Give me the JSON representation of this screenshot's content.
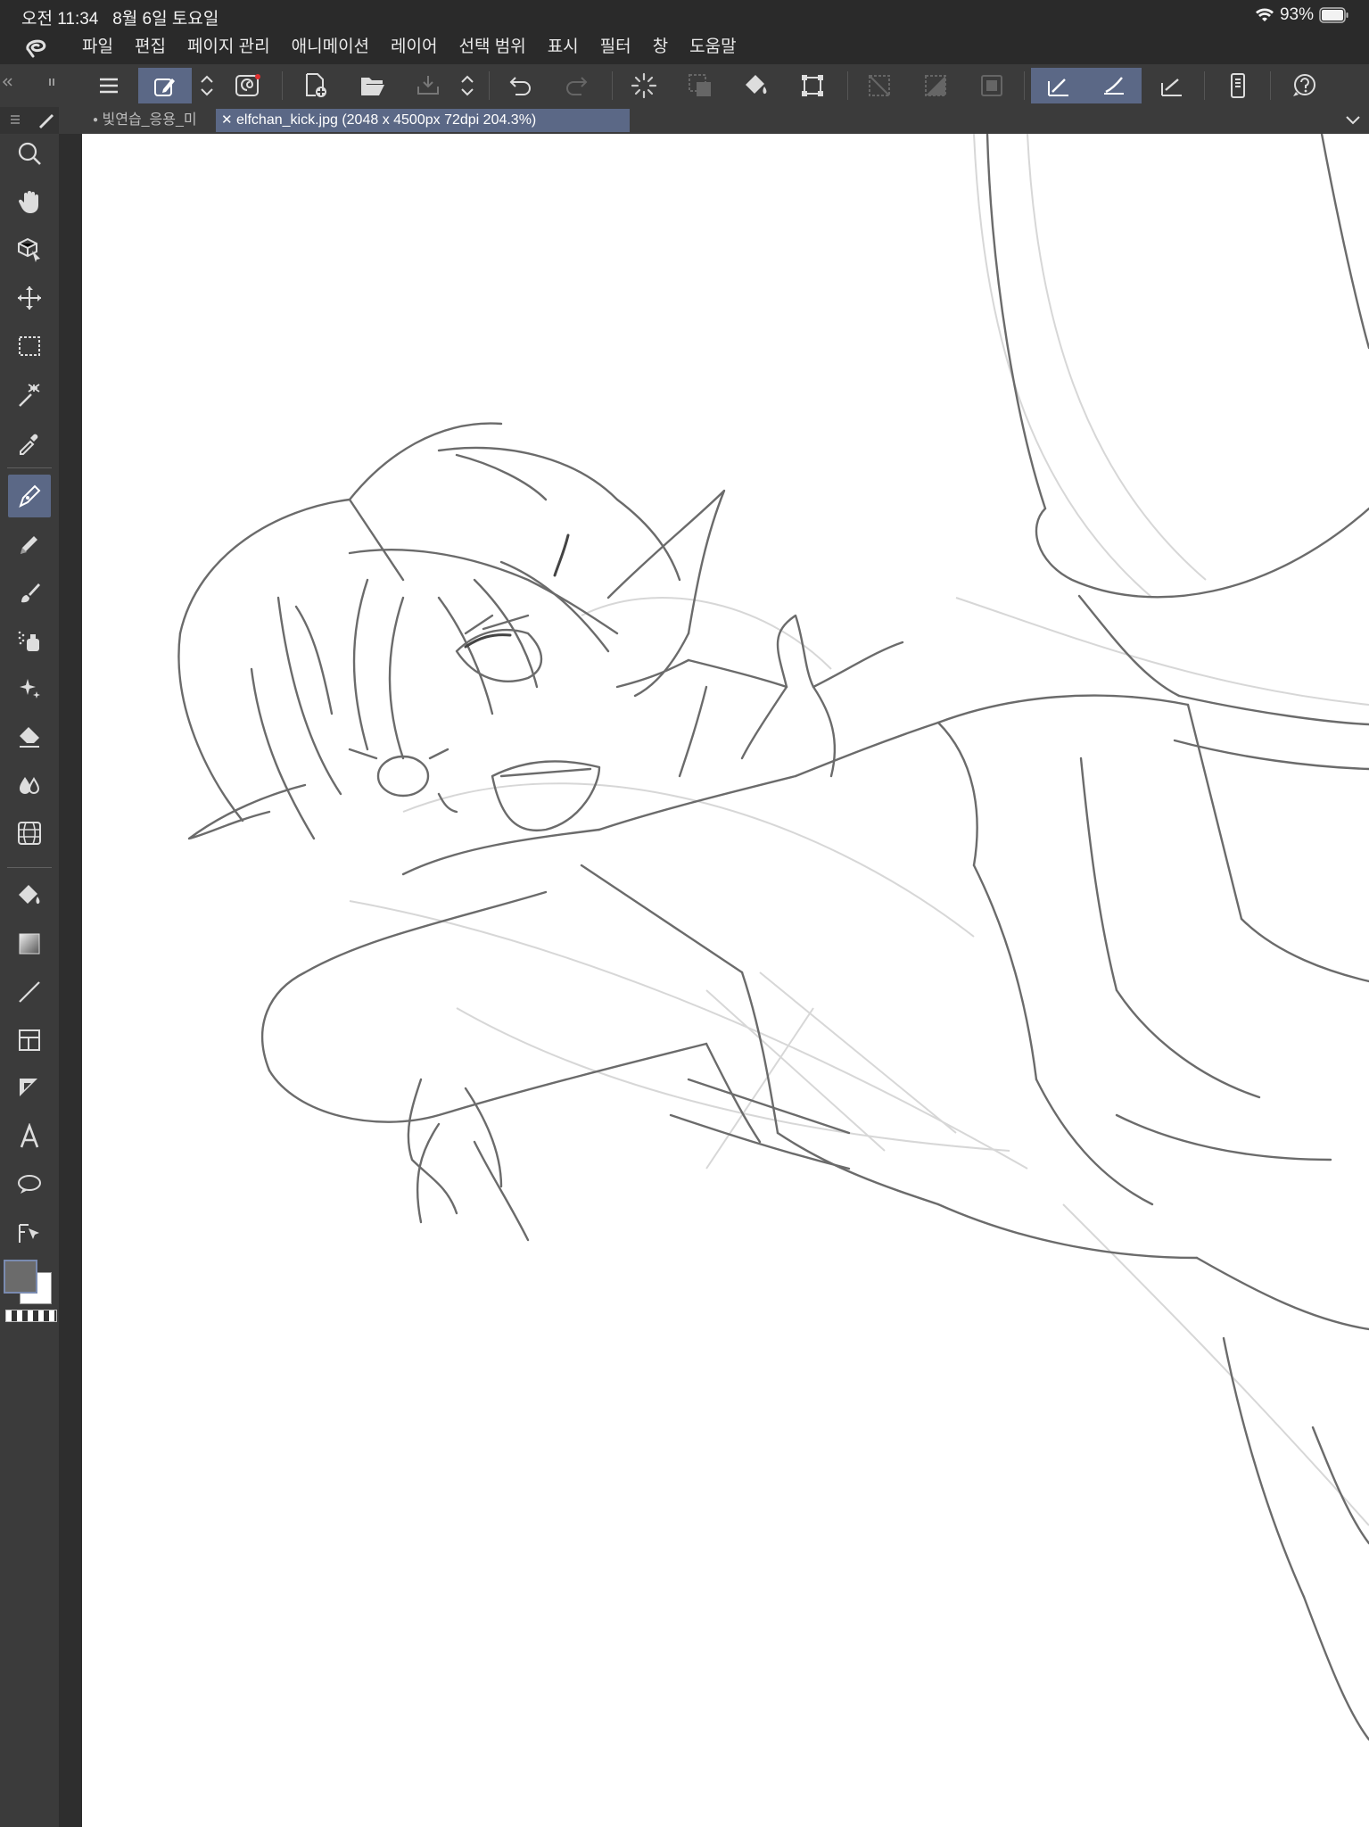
{
  "status_bar": {
    "time": "오전 11:34",
    "date": "8월 6일 토요일",
    "battery": "93%"
  },
  "menu": [
    "파일",
    "편집",
    "페이지 관리",
    "애니메이션",
    "레이어",
    "선택 범위",
    "표시",
    "필터",
    "창",
    "도움말"
  ],
  "tabs": [
    {
      "label": "빛연습_응용_미",
      "active": false
    },
    {
      "label": "elfchan_kick.jpg (2048 x 4500px 72dpi 204.3%)",
      "active": true
    }
  ],
  "colors": {
    "accent": "#5b6886",
    "panel": "#3b3b3b",
    "bar": "#2a2a2a",
    "main_color": "#6b6b6b",
    "sub_color": "#ffffff"
  },
  "tools": [
    "zoom-icon",
    "hand-icon",
    "3d-object-icon",
    "move-icon",
    "rect-select-icon",
    "auto-select-icon",
    "eyedropper-icon",
    "pen-icon",
    "pencil-icon",
    "brush-icon",
    "airbrush-icon",
    "decoration-icon",
    "eraser-icon",
    "blend-icon",
    "perspective-ruler-icon",
    "fill-icon",
    "gradient-icon",
    "figure-icon",
    "frame-icon",
    "ruler-icon",
    "text-icon",
    "balloon-icon",
    "correct-line-icon"
  ]
}
